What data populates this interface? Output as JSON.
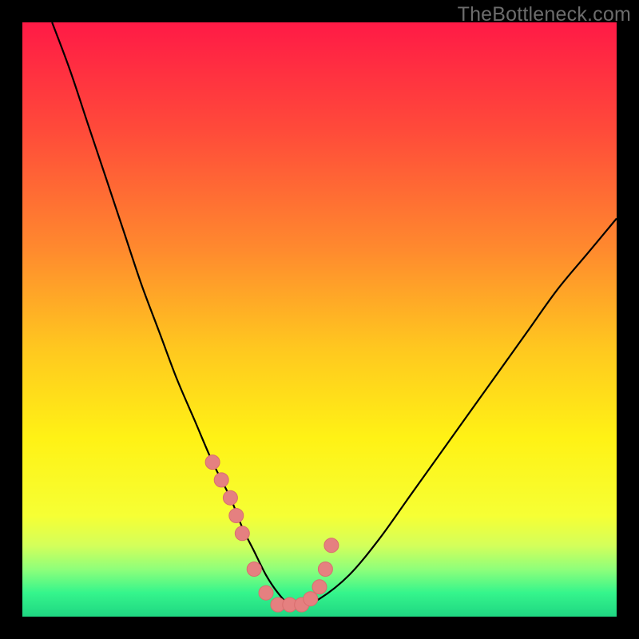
{
  "watermark": "TheBottleneck.com",
  "colors": {
    "frame": "#000000",
    "curve": "#000000",
    "markers": "#e58080",
    "marker_stroke": "#d96e6e"
  },
  "chart_data": {
    "type": "line",
    "title": "",
    "xlabel": "",
    "ylabel": "",
    "xlim": [
      0,
      100
    ],
    "ylim": [
      0,
      100
    ],
    "background_gradient": [
      {
        "pos": 0.0,
        "color": "#ff1a46"
      },
      {
        "pos": 0.18,
        "color": "#ff4a3a"
      },
      {
        "pos": 0.38,
        "color": "#ff892e"
      },
      {
        "pos": 0.55,
        "color": "#ffc81f"
      },
      {
        "pos": 0.7,
        "color": "#fff215"
      },
      {
        "pos": 0.83,
        "color": "#f6ff34"
      },
      {
        "pos": 0.88,
        "color": "#d4ff5a"
      },
      {
        "pos": 0.92,
        "color": "#8fff7a"
      },
      {
        "pos": 0.96,
        "color": "#35f58c"
      },
      {
        "pos": 1.0,
        "color": "#1fd682"
      }
    ],
    "series": [
      {
        "name": "bottleneck-curve",
        "x": [
          5,
          8,
          11,
          14,
          17,
          20,
          23,
          26,
          29,
          32,
          35,
          37,
          39,
          41,
          43,
          45,
          47,
          50,
          55,
          60,
          65,
          70,
          75,
          80,
          85,
          90,
          95,
          100
        ],
        "y": [
          100,
          92,
          83,
          74,
          65,
          56,
          48,
          40,
          33,
          26,
          20,
          15,
          11,
          7,
          4,
          2,
          2,
          3,
          7,
          13,
          20,
          27,
          34,
          41,
          48,
          55,
          61,
          67
        ]
      }
    ],
    "markers": {
      "name": "highlight-points",
      "x": [
        32,
        33.5,
        35,
        36,
        37,
        39,
        41,
        43,
        45,
        47,
        48.5,
        50,
        51,
        52
      ],
      "y": [
        26,
        23,
        20,
        17,
        14,
        8,
        4,
        2,
        2,
        2,
        3,
        5,
        8,
        12
      ]
    }
  }
}
